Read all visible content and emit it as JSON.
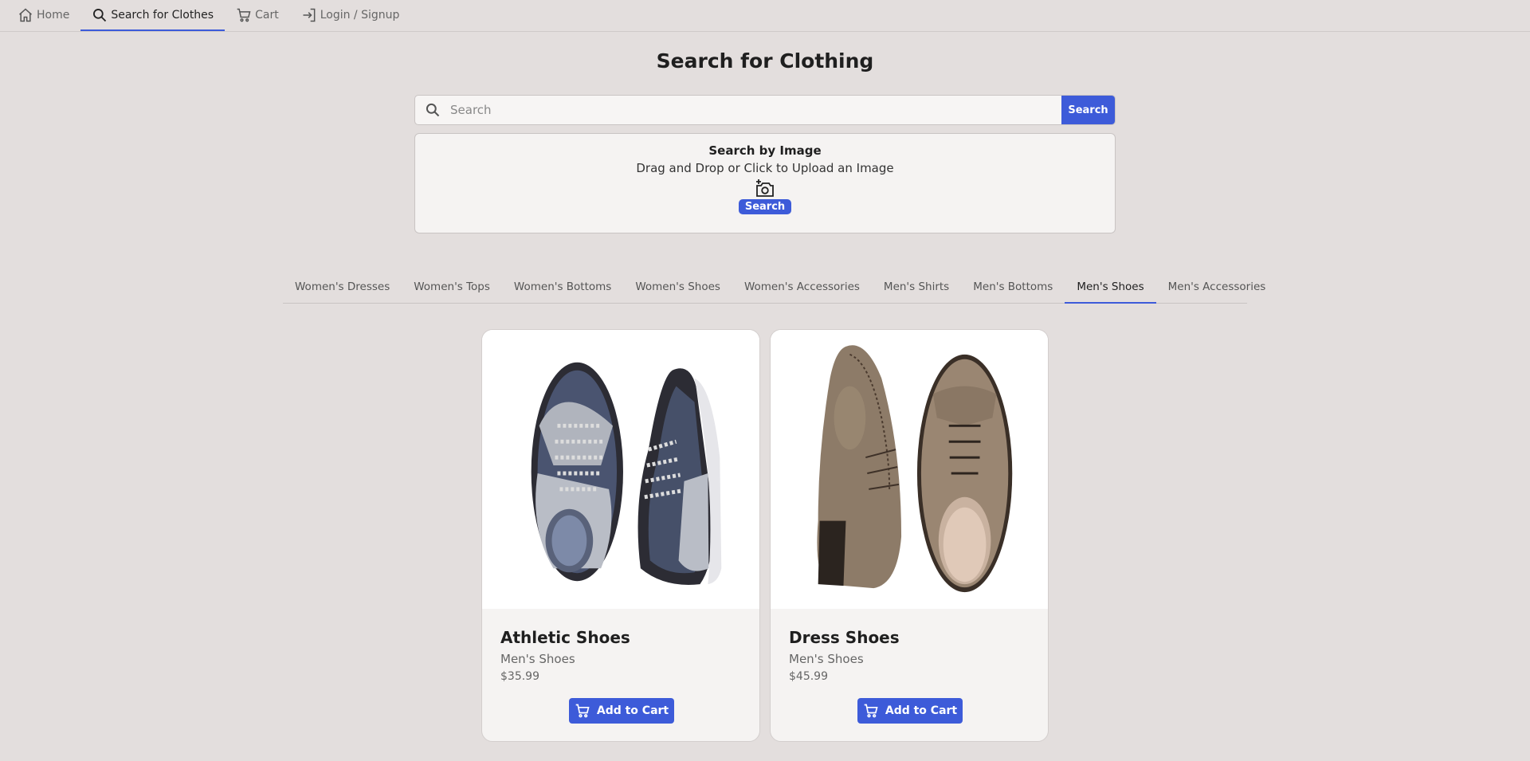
{
  "nav": {
    "items": [
      {
        "label": "Home",
        "icon": "home-icon"
      },
      {
        "label": "Search for Clothes",
        "icon": "search-icon",
        "active": true
      },
      {
        "label": "Cart",
        "icon": "cart-icon"
      },
      {
        "label": "Login / Signup",
        "icon": "login-icon"
      }
    ]
  },
  "page": {
    "title": "Search for Clothing"
  },
  "search": {
    "placeholder": "Search",
    "value": "",
    "button_label": "Search"
  },
  "image_search": {
    "title": "Search by Image",
    "subtitle": "Drag and Drop or Click to Upload an Image",
    "icon": "add-photo-icon",
    "button_label": "Search"
  },
  "categories": {
    "tabs": [
      "Women's Dresses",
      "Women's Tops",
      "Women's Bottoms",
      "Women's Shoes",
      "Women's Accessories",
      "Men's Shirts",
      "Men's Bottoms",
      "Men's Shoes",
      "Men's Accessories"
    ],
    "active": "Men's Shoes"
  },
  "products": [
    {
      "name": "Athletic Shoes",
      "category": "Men's Shoes",
      "price": "$35.99",
      "button_label": "Add to Cart"
    },
    {
      "name": "Dress Shoes",
      "category": "Men's Shoes",
      "price": "$45.99",
      "button_label": "Add to Cart"
    }
  ],
  "colors": {
    "accent": "#3d5bd9",
    "background": "#e3dedd",
    "card": "#f5f3f2"
  }
}
